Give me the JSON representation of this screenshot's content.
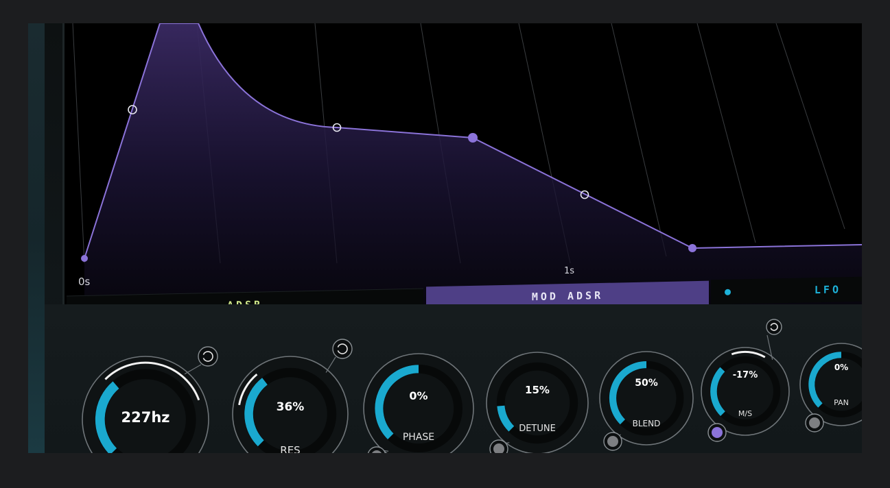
{
  "colors": {
    "envelope": "#8b73d9",
    "accent_cyan": "#1aa9cf",
    "mod_tab": "#4e3f86",
    "adsr_text": "#cfe78a",
    "lfo_text": "#1db2d9"
  },
  "envelope": {
    "time_labels": {
      "start": "0s",
      "mid": "1s"
    }
  },
  "tabs": {
    "adsr": "ADSR",
    "mod_adsr": "MOD ADSR",
    "lfo": "LFO",
    "active": "MOD ADSR"
  },
  "knobs": [
    {
      "id": "cutoff",
      "value": "227hz",
      "name": "",
      "fill": 0.35,
      "mod_ring_icon": "ring-icon"
    },
    {
      "id": "res",
      "value": "36%",
      "name": "RES",
      "fill": 0.36,
      "mod_ring_icon": "ring-icon"
    },
    {
      "id": "phase",
      "value": "0%",
      "name": "PHASE",
      "fill": 0.5
    },
    {
      "id": "detune",
      "value": "15%",
      "name": "DETUNE",
      "fill": 0.15
    },
    {
      "id": "blend",
      "value": "50%",
      "name": "BLEND",
      "fill": 0.5
    },
    {
      "id": "ms",
      "value": "-17%",
      "name": "M/S",
      "fill": 0.33
    },
    {
      "id": "pan",
      "value": "0%",
      "name": "PAN",
      "fill": 0.5
    }
  ]
}
